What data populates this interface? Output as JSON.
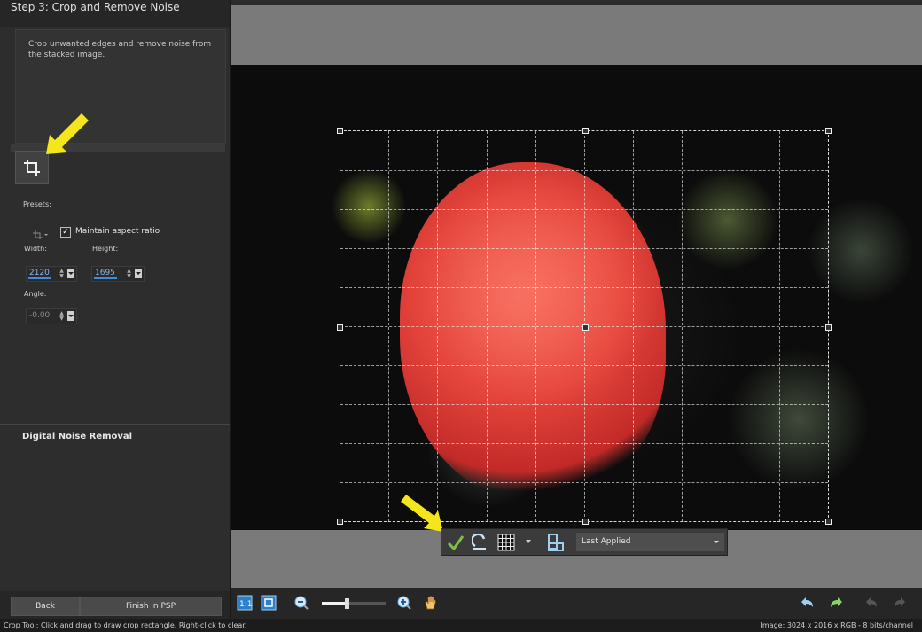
{
  "panel": {
    "step_title": "Step 3: Crop and Remove Noise",
    "description": "Crop unwanted edges and remove noise from the stacked image."
  },
  "crop": {
    "presets_label": "Presets:",
    "maintain_aspect_label": "Maintain aspect ratio",
    "maintain_aspect_checked": true,
    "width_label": "Width:",
    "height_label": "Height:",
    "angle_label": "Angle:",
    "width_value": "2120",
    "height_value": "1695",
    "angle_value": "-0.00"
  },
  "noise": {
    "title": "Digital Noise Removal"
  },
  "buttons": {
    "back": "Back",
    "finish": "Finish in PSP"
  },
  "float_toolbar": {
    "preset_value": "Last Applied"
  },
  "status": {
    "hint": "Crop Tool: Click and drag to draw crop rectangle. Right-click to clear.",
    "image_info": "Image:  3024 x 2016 x RGB - 8 bits/channel"
  },
  "colors": {
    "accent": "#3a8de0",
    "highlight_arrow": "#f5e51b",
    "apply_check": "#7cc242"
  }
}
